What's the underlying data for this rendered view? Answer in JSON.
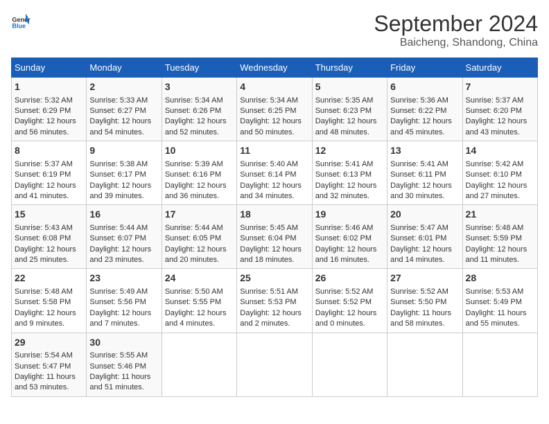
{
  "header": {
    "logo_line1": "General",
    "logo_line2": "Blue",
    "month": "September 2024",
    "location": "Baicheng, Shandong, China"
  },
  "weekdays": [
    "Sunday",
    "Monday",
    "Tuesday",
    "Wednesday",
    "Thursday",
    "Friday",
    "Saturday"
  ],
  "weeks": [
    [
      {
        "day": "1",
        "sunrise": "Sunrise: 5:32 AM",
        "sunset": "Sunset: 6:29 PM",
        "daylight": "Daylight: 12 hours and 56 minutes."
      },
      {
        "day": "2",
        "sunrise": "Sunrise: 5:33 AM",
        "sunset": "Sunset: 6:27 PM",
        "daylight": "Daylight: 12 hours and 54 minutes."
      },
      {
        "day": "3",
        "sunrise": "Sunrise: 5:34 AM",
        "sunset": "Sunset: 6:26 PM",
        "daylight": "Daylight: 12 hours and 52 minutes."
      },
      {
        "day": "4",
        "sunrise": "Sunrise: 5:34 AM",
        "sunset": "Sunset: 6:25 PM",
        "daylight": "Daylight: 12 hours and 50 minutes."
      },
      {
        "day": "5",
        "sunrise": "Sunrise: 5:35 AM",
        "sunset": "Sunset: 6:23 PM",
        "daylight": "Daylight: 12 hours and 48 minutes."
      },
      {
        "day": "6",
        "sunrise": "Sunrise: 5:36 AM",
        "sunset": "Sunset: 6:22 PM",
        "daylight": "Daylight: 12 hours and 45 minutes."
      },
      {
        "day": "7",
        "sunrise": "Sunrise: 5:37 AM",
        "sunset": "Sunset: 6:20 PM",
        "daylight": "Daylight: 12 hours and 43 minutes."
      }
    ],
    [
      {
        "day": "8",
        "sunrise": "Sunrise: 5:37 AM",
        "sunset": "Sunset: 6:19 PM",
        "daylight": "Daylight: 12 hours and 41 minutes."
      },
      {
        "day": "9",
        "sunrise": "Sunrise: 5:38 AM",
        "sunset": "Sunset: 6:17 PM",
        "daylight": "Daylight: 12 hours and 39 minutes."
      },
      {
        "day": "10",
        "sunrise": "Sunrise: 5:39 AM",
        "sunset": "Sunset: 6:16 PM",
        "daylight": "Daylight: 12 hours and 36 minutes."
      },
      {
        "day": "11",
        "sunrise": "Sunrise: 5:40 AM",
        "sunset": "Sunset: 6:14 PM",
        "daylight": "Daylight: 12 hours and 34 minutes."
      },
      {
        "day": "12",
        "sunrise": "Sunrise: 5:41 AM",
        "sunset": "Sunset: 6:13 PM",
        "daylight": "Daylight: 12 hours and 32 minutes."
      },
      {
        "day": "13",
        "sunrise": "Sunrise: 5:41 AM",
        "sunset": "Sunset: 6:11 PM",
        "daylight": "Daylight: 12 hours and 30 minutes."
      },
      {
        "day": "14",
        "sunrise": "Sunrise: 5:42 AM",
        "sunset": "Sunset: 6:10 PM",
        "daylight": "Daylight: 12 hours and 27 minutes."
      }
    ],
    [
      {
        "day": "15",
        "sunrise": "Sunrise: 5:43 AM",
        "sunset": "Sunset: 6:08 PM",
        "daylight": "Daylight: 12 hours and 25 minutes."
      },
      {
        "day": "16",
        "sunrise": "Sunrise: 5:44 AM",
        "sunset": "Sunset: 6:07 PM",
        "daylight": "Daylight: 12 hours and 23 minutes."
      },
      {
        "day": "17",
        "sunrise": "Sunrise: 5:44 AM",
        "sunset": "Sunset: 6:05 PM",
        "daylight": "Daylight: 12 hours and 20 minutes."
      },
      {
        "day": "18",
        "sunrise": "Sunrise: 5:45 AM",
        "sunset": "Sunset: 6:04 PM",
        "daylight": "Daylight: 12 hours and 18 minutes."
      },
      {
        "day": "19",
        "sunrise": "Sunrise: 5:46 AM",
        "sunset": "Sunset: 6:02 PM",
        "daylight": "Daylight: 12 hours and 16 minutes."
      },
      {
        "day": "20",
        "sunrise": "Sunrise: 5:47 AM",
        "sunset": "Sunset: 6:01 PM",
        "daylight": "Daylight: 12 hours and 14 minutes."
      },
      {
        "day": "21",
        "sunrise": "Sunrise: 5:48 AM",
        "sunset": "Sunset: 5:59 PM",
        "daylight": "Daylight: 12 hours and 11 minutes."
      }
    ],
    [
      {
        "day": "22",
        "sunrise": "Sunrise: 5:48 AM",
        "sunset": "Sunset: 5:58 PM",
        "daylight": "Daylight: 12 hours and 9 minutes."
      },
      {
        "day": "23",
        "sunrise": "Sunrise: 5:49 AM",
        "sunset": "Sunset: 5:56 PM",
        "daylight": "Daylight: 12 hours and 7 minutes."
      },
      {
        "day": "24",
        "sunrise": "Sunrise: 5:50 AM",
        "sunset": "Sunset: 5:55 PM",
        "daylight": "Daylight: 12 hours and 4 minutes."
      },
      {
        "day": "25",
        "sunrise": "Sunrise: 5:51 AM",
        "sunset": "Sunset: 5:53 PM",
        "daylight": "Daylight: 12 hours and 2 minutes."
      },
      {
        "day": "26",
        "sunrise": "Sunrise: 5:52 AM",
        "sunset": "Sunset: 5:52 PM",
        "daylight": "Daylight: 12 hours and 0 minutes."
      },
      {
        "day": "27",
        "sunrise": "Sunrise: 5:52 AM",
        "sunset": "Sunset: 5:50 PM",
        "daylight": "Daylight: 11 hours and 58 minutes."
      },
      {
        "day": "28",
        "sunrise": "Sunrise: 5:53 AM",
        "sunset": "Sunset: 5:49 PM",
        "daylight": "Daylight: 11 hours and 55 minutes."
      }
    ],
    [
      {
        "day": "29",
        "sunrise": "Sunrise: 5:54 AM",
        "sunset": "Sunset: 5:47 PM",
        "daylight": "Daylight: 11 hours and 53 minutes."
      },
      {
        "day": "30",
        "sunrise": "Sunrise: 5:55 AM",
        "sunset": "Sunset: 5:46 PM",
        "daylight": "Daylight: 11 hours and 51 minutes."
      },
      null,
      null,
      null,
      null,
      null
    ]
  ]
}
